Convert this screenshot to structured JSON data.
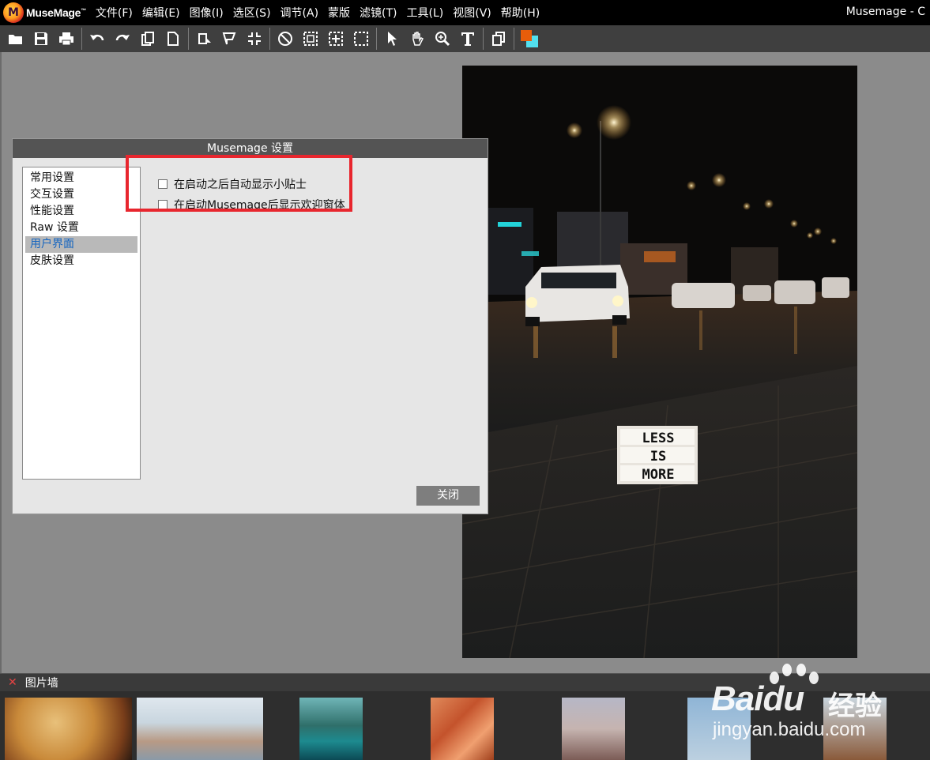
{
  "app": {
    "logo_letter": "M",
    "logo_name": "MuseMage",
    "logo_mark": "™",
    "window_title": "Musemage - C"
  },
  "menu": [
    "文件(F)",
    "编辑(E)",
    "图像(I)",
    "选区(S)",
    "调节(A)",
    "蒙版",
    "滤镜(T)",
    "工具(L)",
    "视图(V)",
    "帮助(H)"
  ],
  "toolbar": {
    "icons": [
      "open-folder-icon",
      "save-icon",
      "print-icon",
      "undo-icon",
      "redo-icon",
      "copy-icon",
      "new-page-icon",
      "rotate-icon",
      "flip-icon",
      "crop-icon",
      "no-selection-icon",
      "rect-select-icon",
      "select-add-icon",
      "select-dashed-icon",
      "pointer-icon",
      "hand-icon",
      "zoom-icon",
      "text-icon",
      "layers-icon",
      "color-swatch-icon"
    ],
    "fg_color": "#e85d0a",
    "bg_color": "#52e0ef"
  },
  "dialog": {
    "title": "Musemage 设置",
    "nav": [
      "常用设置",
      "交互设置",
      "性能设置",
      "Raw 设置",
      "用户界面",
      "皮肤设置"
    ],
    "selected_nav": "用户界面",
    "options": [
      {
        "label": "在启动之后自动显示小贴士",
        "checked": false
      },
      {
        "label": "在启动Musemage后显示欢迎窗体",
        "checked": false
      }
    ],
    "close_label": "关闭"
  },
  "photo": {
    "sign_lines": [
      "LESS",
      "IS",
      "MORE"
    ]
  },
  "picture_wall": {
    "title": "图片墙",
    "thumbnails": [
      "pizza",
      "venice",
      "lake",
      "canyon",
      "colosseum",
      "tower",
      "palm"
    ]
  },
  "watermark": {
    "brand": "Baidu",
    "cn": "经验",
    "url": "jingyan.baidu.com"
  }
}
